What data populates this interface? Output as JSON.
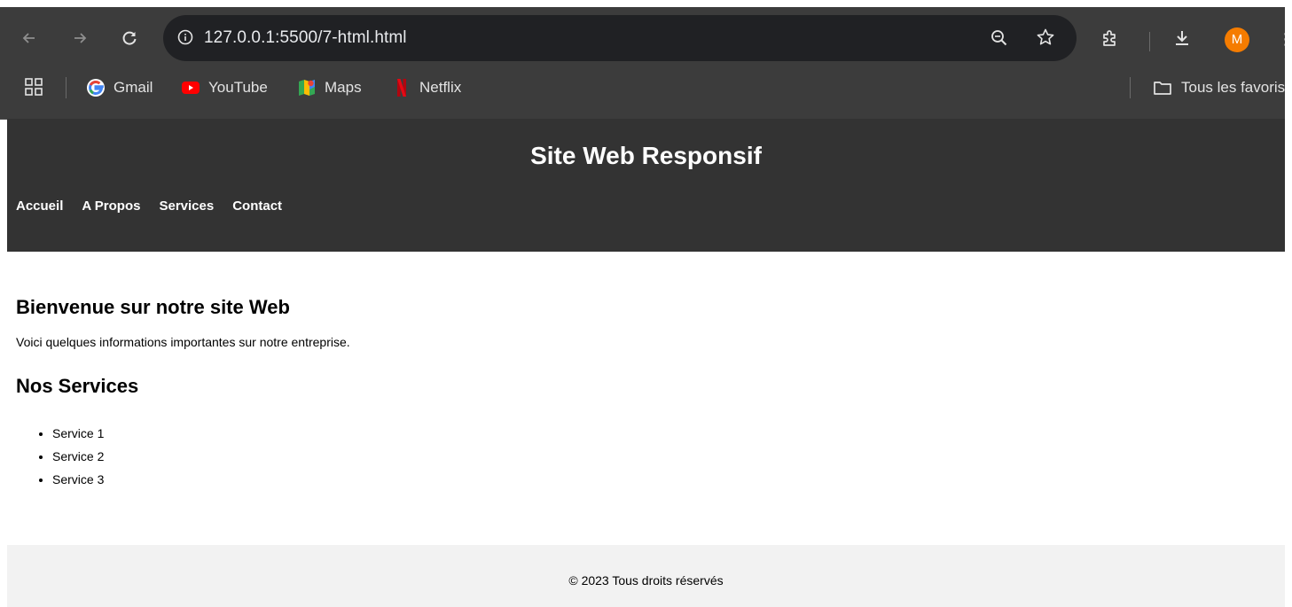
{
  "browser": {
    "url": "127.0.0.1:5500/7-html.html",
    "profile_initial": "M",
    "bookmarks": [
      {
        "label": "Gmail",
        "icon": "google-icon"
      },
      {
        "label": "YouTube",
        "icon": "youtube-icon"
      },
      {
        "label": "Maps",
        "icon": "maps-icon"
      },
      {
        "label": "Netflix",
        "icon": "netflix-icon"
      }
    ],
    "all_bookmarks_label": "Tous les favoris",
    "colors": {
      "chrome_bg": "#3c3c3c",
      "omnibox_bg": "#202124",
      "avatar": "#f57c00"
    }
  },
  "site": {
    "title": "Site Web Responsif",
    "nav": [
      "Accueil",
      "A Propos",
      "Services",
      "Contact"
    ],
    "welcome_heading": "Bienvenue sur notre site Web",
    "intro": "Voici quelques informations importantes sur notre entreprise.",
    "services_heading": "Nos Services",
    "services": [
      "Service 1",
      "Service 2",
      "Service 3"
    ],
    "footer": "© 2023 Tous droits réservés",
    "colors": {
      "header_bg": "#333333",
      "footer_bg": "#f2f2f2"
    }
  }
}
